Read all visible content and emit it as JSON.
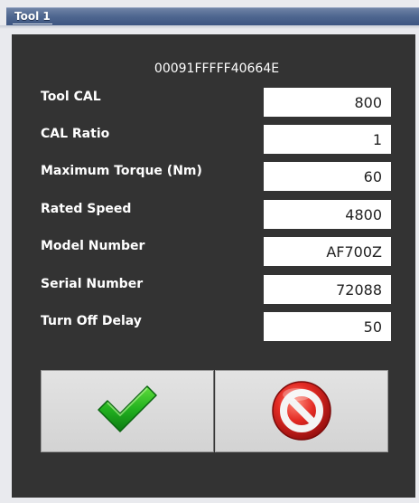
{
  "window": {
    "title": "Tool 1"
  },
  "panel": {
    "device_id": "00091FFFFF40664E",
    "fields": [
      {
        "label": "Tool CAL",
        "value": "800"
      },
      {
        "label": "CAL Ratio",
        "value": "1"
      },
      {
        "label": "Maximum Torque (Nm)",
        "value": "60"
      },
      {
        "label": "Rated Speed",
        "value": "4800"
      },
      {
        "label": "Model Number",
        "value": "AF700Z"
      },
      {
        "label": "Serial Number",
        "value": "72088"
      },
      {
        "label": "Turn Off Delay",
        "value": "50"
      }
    ]
  },
  "buttons": {
    "ok_icon": "green-checkmark-icon",
    "cancel_icon": "red-no-entry-icon"
  },
  "colors": {
    "panel_bg": "#333333",
    "title_bar": "#4f6790",
    "ok_green": "#1fa31f",
    "cancel_red": "#d61f1f"
  }
}
